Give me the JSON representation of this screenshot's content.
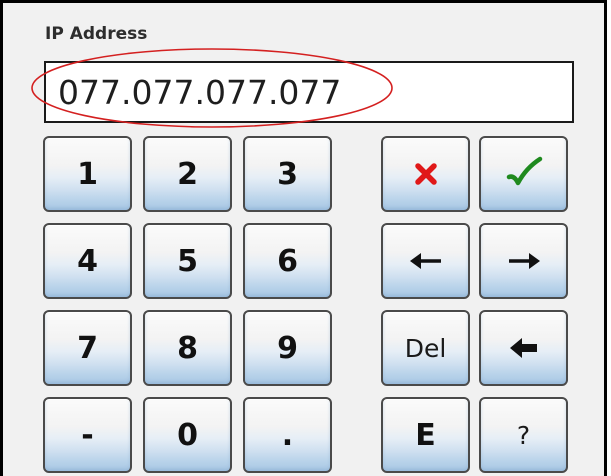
{
  "dialog": {
    "field_label": "IP Address",
    "ip_value": "077.077.077.077"
  },
  "keypad": {
    "k1": "1",
    "k2": "2",
    "k3": "3",
    "k4": "4",
    "k5": "5",
    "k6": "6",
    "k7": "7",
    "k8": "8",
    "k9": "9",
    "k0": "0",
    "minus": "-",
    "dot": ".",
    "del": "Del",
    "e": "E",
    "help": "?"
  },
  "icons": {
    "cancel": "red-x-icon",
    "confirm": "green-checkmark-icon",
    "left": "left-arrow-icon",
    "right": "right-arrow-icon",
    "backspace": "backspace-arrow-icon"
  },
  "colors": {
    "cancel_red": "#e01818",
    "confirm_green": "#1f8a1f",
    "highlight_ellipse": "#d42020",
    "key_gradient_bottom": "#a8c7e4"
  }
}
